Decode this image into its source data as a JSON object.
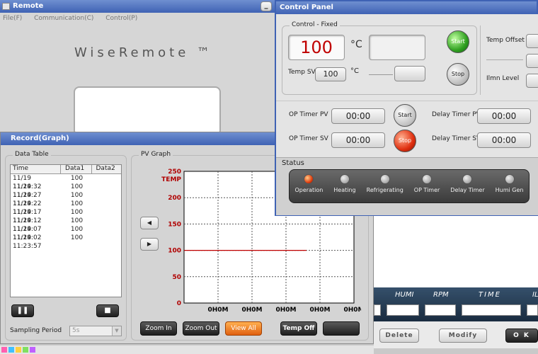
{
  "remote": {
    "title": "Remote",
    "menu": [
      "File(F)",
      "Communication(C)",
      "Control(P)"
    ],
    "brand": "WiseRemote ™"
  },
  "record": {
    "title": "Record(Graph)",
    "data_table_label": "Data Table",
    "columns": [
      "Time",
      "Data1",
      "Data2"
    ],
    "rows": [
      [
        "11/19 11:24:32",
        "100",
        ""
      ],
      [
        "11/19 11:24:27",
        "100",
        ""
      ],
      [
        "11/19 11:24:22",
        "100",
        ""
      ],
      [
        "11/19 11:24:17",
        "100",
        ""
      ],
      [
        "11/19 11:24:12",
        "100",
        ""
      ],
      [
        "11/19 11:24:07",
        "100",
        ""
      ],
      [
        "11/19 11:24:02",
        "100",
        ""
      ],
      [
        "11/19 11:23:57",
        "100",
        ""
      ]
    ],
    "sampling_label": "Sampling Period",
    "sampling_value": "5s",
    "graph_label": "PV Graph",
    "y_axis_title": "TEMP",
    "y_ticks": [
      "250",
      "200",
      "150",
      "100",
      "50",
      "0"
    ],
    "x_ticks": [
      "0H0M",
      "0H0M",
      "0H0M",
      "0H0M",
      "0H0M"
    ],
    "buttons": {
      "zoom_in": "Zoom In",
      "zoom_out": "Zoom Out",
      "view_all": "View All",
      "temp_off": "Temp Off"
    }
  },
  "chart_data": {
    "type": "line",
    "ylabel": "TEMP",
    "ylim": [
      0,
      250
    ],
    "y_ticks": [
      250,
      200,
      150,
      100,
      50,
      0
    ],
    "x_tick_labels": [
      "0H0M",
      "0H0M",
      "0H0M",
      "0H0M",
      "0H0M"
    ],
    "series": [
      {
        "values": [
          100,
          100
        ]
      }
    ],
    "grid": true,
    "line_color": "#c00000"
  },
  "control": {
    "title": "Control Panel",
    "fixed_label": "Control - Fixed",
    "pv_value": "100",
    "pv_unit": "°C",
    "temp_sv_label": "Temp SV",
    "temp_sv_value": "100",
    "temp_sv_unit": "°C",
    "start": "Start",
    "stop": "Stop",
    "temp_offset": "Temp Offset",
    "ilmn_level": "Ilmn Level",
    "op_timer_pv": "OP Timer PV",
    "op_timer_pv_value": "00:00",
    "op_timer_sv": "OP Timer SV",
    "op_timer_sv_value": "00:00",
    "delay_timer_pv": "Delay Timer PV",
    "delay_timer_pv_value": "00:00",
    "delay_timer_sv": "Delay Timer SV",
    "delay_timer_sv_value": "00:00",
    "status_label": "Status",
    "status": [
      "Operation",
      "Heating",
      "Refrigerating",
      "OP Timer",
      "Delay Timer",
      "Humi Gen"
    ]
  },
  "bottom": {
    "columns": [
      "HUMI",
      "RPM",
      "TIME",
      "IL"
    ],
    "delete": "Delete",
    "modify": "Modify",
    "ok": "O K"
  }
}
